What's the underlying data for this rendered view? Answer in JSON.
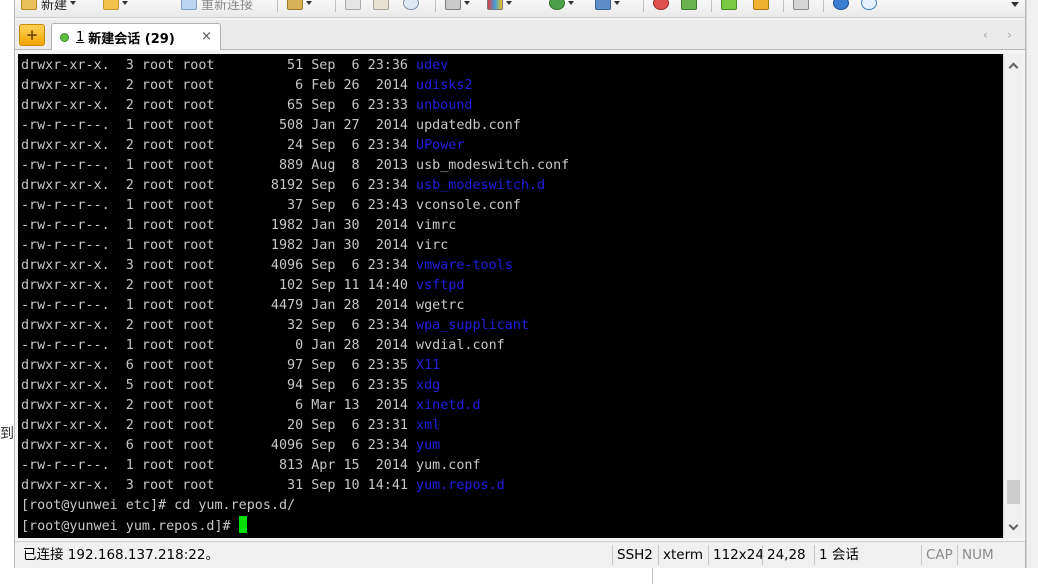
{
  "toolbar": {
    "new_label": "新建",
    "reconnect_label": "重新连接"
  },
  "tabs": [
    {
      "number": "1",
      "label": "新建会话 (29)",
      "close": "×"
    }
  ],
  "tab_nav": {
    "prev": "‹",
    "next": "›"
  },
  "background": {
    "left_char": "到"
  },
  "terminal": {
    "listing": [
      {
        "perm": "drwxr-xr-x.",
        "links": "3",
        "owner": "root",
        "group": "root",
        "size": "51",
        "month": "Sep",
        "day": "6",
        "time": "23:36",
        "name": "udev",
        "type": "dir"
      },
      {
        "perm": "drwxr-xr-x.",
        "links": "2",
        "owner": "root",
        "group": "root",
        "size": "6",
        "month": "Feb",
        "day": "26",
        "time": "2014",
        "name": "udisks2",
        "type": "dir"
      },
      {
        "perm": "drwxr-xr-x.",
        "links": "2",
        "owner": "root",
        "group": "root",
        "size": "65",
        "month": "Sep",
        "day": "6",
        "time": "23:33",
        "name": "unbound",
        "type": "dir"
      },
      {
        "perm": "-rw-r--r--.",
        "links": "1",
        "owner": "root",
        "group": "root",
        "size": "508",
        "month": "Jan",
        "day": "27",
        "time": "2014",
        "name": "updatedb.conf",
        "type": "file"
      },
      {
        "perm": "drwxr-xr-x.",
        "links": "2",
        "owner": "root",
        "group": "root",
        "size": "24",
        "month": "Sep",
        "day": "6",
        "time": "23:34",
        "name": "UPower",
        "type": "dir"
      },
      {
        "perm": "-rw-r--r--.",
        "links": "1",
        "owner": "root",
        "group": "root",
        "size": "889",
        "month": "Aug",
        "day": "8",
        "time": "2013",
        "name": "usb_modeswitch.conf",
        "type": "file"
      },
      {
        "perm": "drwxr-xr-x.",
        "links": "2",
        "owner": "root",
        "group": "root",
        "size": "8192",
        "month": "Sep",
        "day": "6",
        "time": "23:34",
        "name": "usb_modeswitch.d",
        "type": "dir"
      },
      {
        "perm": "-rw-r--r--.",
        "links": "1",
        "owner": "root",
        "group": "root",
        "size": "37",
        "month": "Sep",
        "day": "6",
        "time": "23:43",
        "name": "vconsole.conf",
        "type": "file"
      },
      {
        "perm": "-rw-r--r--.",
        "links": "1",
        "owner": "root",
        "group": "root",
        "size": "1982",
        "month": "Jan",
        "day": "30",
        "time": "2014",
        "name": "vimrc",
        "type": "file"
      },
      {
        "perm": "-rw-r--r--.",
        "links": "1",
        "owner": "root",
        "group": "root",
        "size": "1982",
        "month": "Jan",
        "day": "30",
        "time": "2014",
        "name": "virc",
        "type": "file"
      },
      {
        "perm": "drwxr-xr-x.",
        "links": "3",
        "owner": "root",
        "group": "root",
        "size": "4096",
        "month": "Sep",
        "day": "6",
        "time": "23:34",
        "name": "vmware-tools",
        "type": "dir"
      },
      {
        "perm": "drwxr-xr-x.",
        "links": "2",
        "owner": "root",
        "group": "root",
        "size": "102",
        "month": "Sep",
        "day": "11",
        "time": "14:40",
        "name": "vsftpd",
        "type": "dir"
      },
      {
        "perm": "-rw-r--r--.",
        "links": "1",
        "owner": "root",
        "group": "root",
        "size": "4479",
        "month": "Jan",
        "day": "28",
        "time": "2014",
        "name": "wgetrc",
        "type": "file"
      },
      {
        "perm": "drwxr-xr-x.",
        "links": "2",
        "owner": "root",
        "group": "root",
        "size": "32",
        "month": "Sep",
        "day": "6",
        "time": "23:34",
        "name": "wpa_supplicant",
        "type": "dir"
      },
      {
        "perm": "-rw-r--r--.",
        "links": "1",
        "owner": "root",
        "group": "root",
        "size": "0",
        "month": "Jan",
        "day": "28",
        "time": "2014",
        "name": "wvdial.conf",
        "type": "file"
      },
      {
        "perm": "drwxr-xr-x.",
        "links": "6",
        "owner": "root",
        "group": "root",
        "size": "97",
        "month": "Sep",
        "day": "6",
        "time": "23:35",
        "name": "X11",
        "type": "dir"
      },
      {
        "perm": "drwxr-xr-x.",
        "links": "5",
        "owner": "root",
        "group": "root",
        "size": "94",
        "month": "Sep",
        "day": "6",
        "time": "23:35",
        "name": "xdg",
        "type": "dir"
      },
      {
        "perm": "drwxr-xr-x.",
        "links": "2",
        "owner": "root",
        "group": "root",
        "size": "6",
        "month": "Mar",
        "day": "13",
        "time": "2014",
        "name": "xinetd.d",
        "type": "dir"
      },
      {
        "perm": "drwxr-xr-x.",
        "links": "2",
        "owner": "root",
        "group": "root",
        "size": "20",
        "month": "Sep",
        "day": "6",
        "time": "23:31",
        "name": "xml",
        "type": "dir"
      },
      {
        "perm": "drwxr-xr-x.",
        "links": "6",
        "owner": "root",
        "group": "root",
        "size": "4096",
        "month": "Sep",
        "day": "6",
        "time": "23:34",
        "name": "yum",
        "type": "dir"
      },
      {
        "perm": "-rw-r--r--.",
        "links": "1",
        "owner": "root",
        "group": "root",
        "size": "813",
        "month": "Apr",
        "day": "15",
        "time": "2014",
        "name": "yum.conf",
        "type": "file"
      },
      {
        "perm": "drwxr-xr-x.",
        "links": "3",
        "owner": "root",
        "group": "root",
        "size": "31",
        "month": "Sep",
        "day": "10",
        "time": "14:41",
        "name": "yum.repos.d",
        "type": "dir"
      }
    ],
    "command_line": "[root@yunwei etc]# cd yum.repos.d/",
    "prompt": "[root@yunwei yum.repos.d]# ",
    "dir_color": "#2020e0",
    "text_color": "#c7c7c7",
    "cursor_color": "#00e000"
  },
  "scrollbar": {
    "position_fraction": 0.97
  },
  "statusbar": {
    "connection": "已连接 192.168.137.218:22。",
    "protocol": "SSH2",
    "terminal_type": "xterm",
    "size": "112x24",
    "cursor_pos": "24,28",
    "sessions": "1 会话",
    "caps": "CAP",
    "num": "NUM"
  }
}
